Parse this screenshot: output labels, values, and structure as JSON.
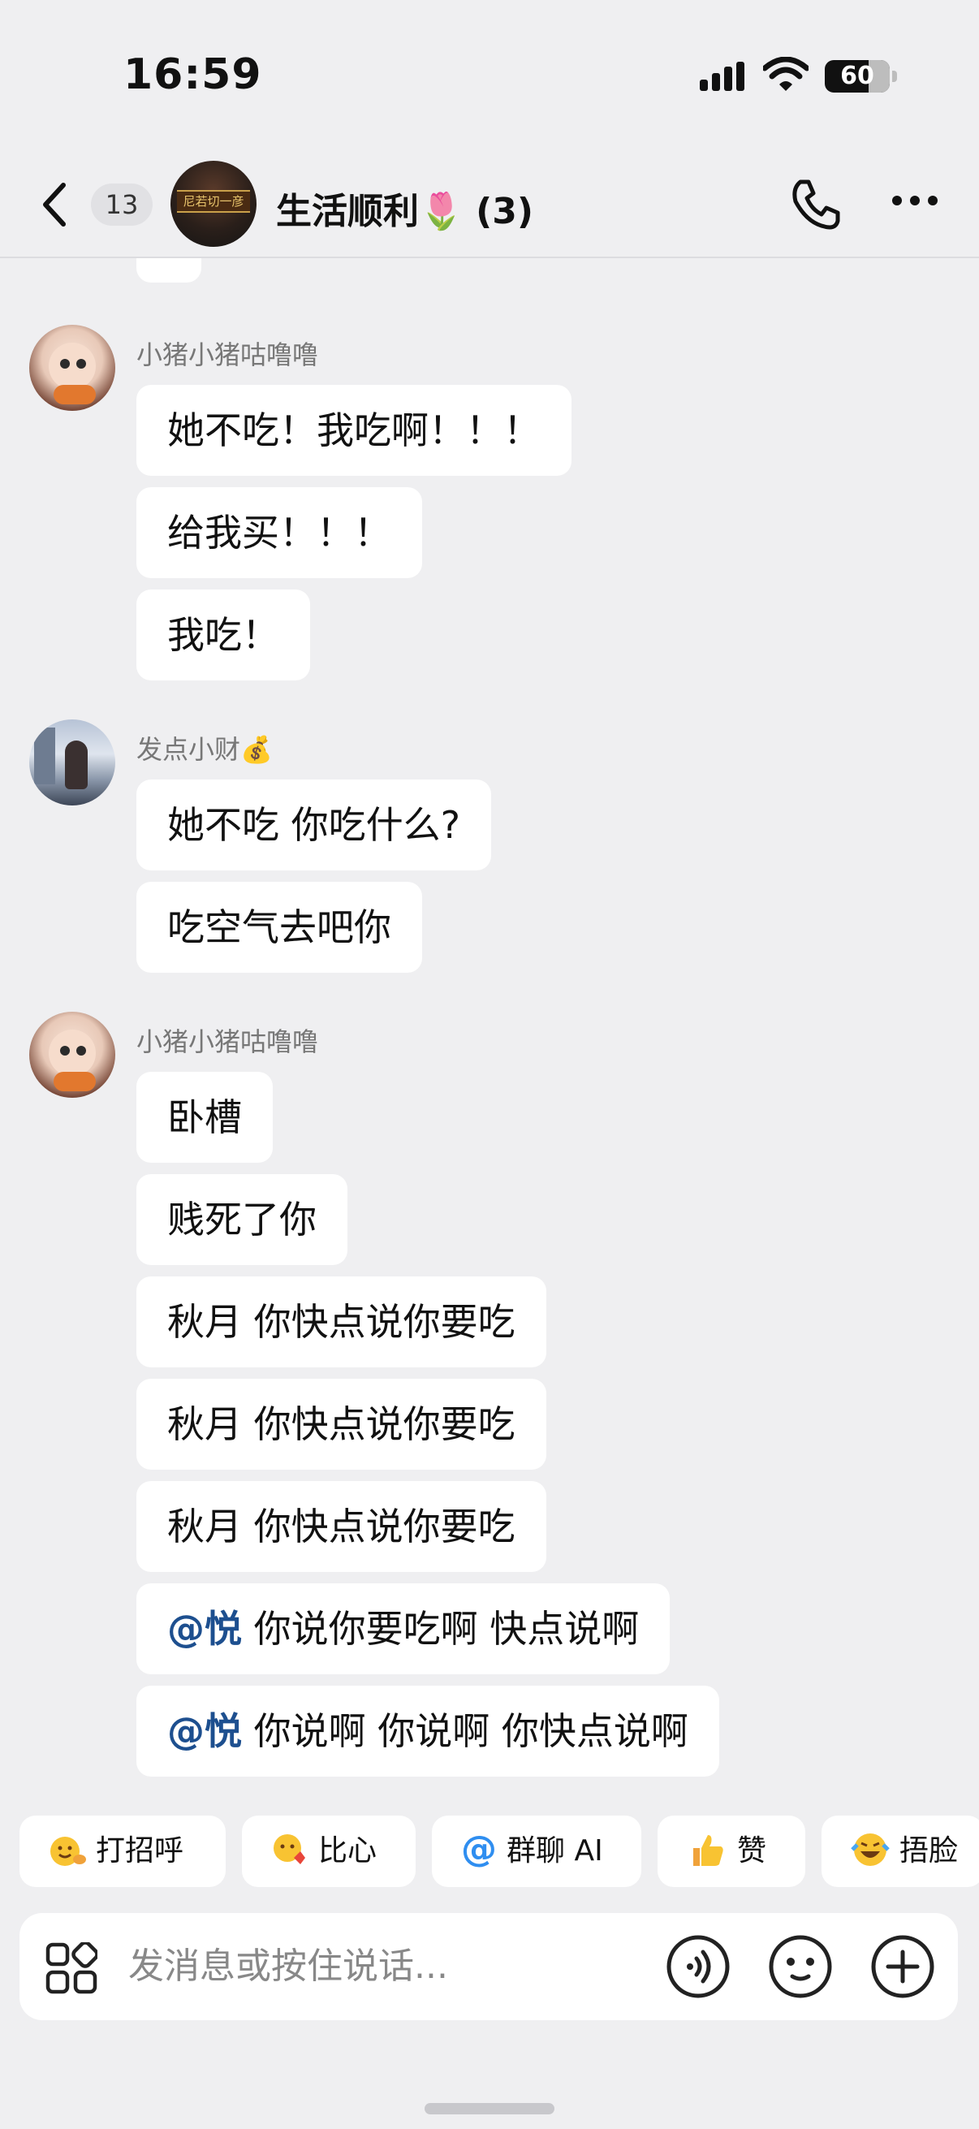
{
  "status_bar": {
    "time": "16:59",
    "battery": "60",
    "battery_level": 0.6
  },
  "header": {
    "back_label": "back",
    "unread_count": "13",
    "group_title": "生活顺利🌷 (3)",
    "avatar_sign_text": "尼若切一彦"
  },
  "messages": [
    {
      "sender": "小猪小猪咕噜噜",
      "texts": [
        "她不吃！我吃啊！！！",
        "给我买！！！",
        "我吃！"
      ]
    },
    {
      "sender": "发点小财💰",
      "texts": [
        "她不吃 你吃什么?",
        "吃空气去吧你"
      ]
    },
    {
      "sender": "小猪小猪咕噜噜",
      "texts": [
        "卧槽",
        "贱死了你",
        "秋月 你快点说你要吃",
        "秋月 你快点说你要吃",
        "秋月 你快点说你要吃"
      ],
      "mention_texts": [
        {
          "mention": "@悦",
          "text": " 你说你要吃啊 快点说啊"
        },
        {
          "mention": "@悦",
          "text": " 你说啊 你说啊 你快点说啊"
        }
      ]
    }
  ],
  "quick_replies": [
    "打招呼",
    "比心",
    "群聊 AI",
    "赞",
    "捂脸"
  ],
  "input": {
    "placeholder": "发消息或按住说话..."
  },
  "icons": [
    "back-icon",
    "phone-icon",
    "more-icon",
    "apps-icon",
    "voice-icon",
    "emoji-icon",
    "plus-icon"
  ]
}
